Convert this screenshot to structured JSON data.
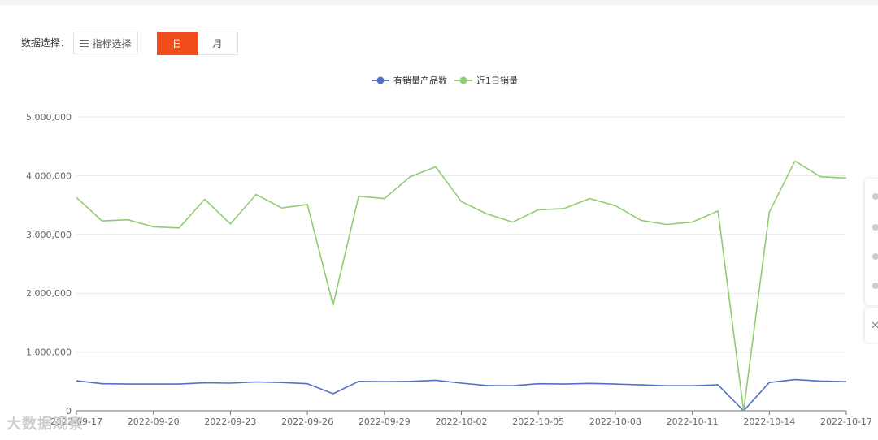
{
  "filter": {
    "label": "数据选择：",
    "metric_button": "指标选择",
    "period_day": "日",
    "period_month": "月",
    "active_period": "日"
  },
  "colors": {
    "accent": "#f04c1c",
    "series1": "#5470c6",
    "series2": "#91cc75"
  },
  "watermark": "大数据观察",
  "chart_data": {
    "type": "line",
    "title": "",
    "xlabel": "",
    "ylabel": "",
    "ylim": [
      0,
      5000000
    ],
    "yticks": [
      0,
      1000000,
      2000000,
      3000000,
      4000000,
      5000000
    ],
    "ytick_labels": [
      "0",
      "1,000,000",
      "2,000,000",
      "3,000,000",
      "4,000,000",
      "5,000,000"
    ],
    "xtick_labels": [
      "2022-09-17",
      "2022-09-20",
      "2022-09-23",
      "2022-09-26",
      "2022-09-29",
      "2022-10-02",
      "2022-10-05",
      "2022-10-08",
      "2022-10-11",
      "2022-10-14",
      "2022-10-17"
    ],
    "legend_position": "top-center",
    "grid": true,
    "x": [
      "2022-09-17",
      "2022-09-18",
      "2022-09-19",
      "2022-09-20",
      "2022-09-21",
      "2022-09-22",
      "2022-09-23",
      "2022-09-24",
      "2022-09-25",
      "2022-09-26",
      "2022-09-27",
      "2022-09-28",
      "2022-09-29",
      "2022-09-30",
      "2022-10-01",
      "2022-10-02",
      "2022-10-03",
      "2022-10-04",
      "2022-10-05",
      "2022-10-06",
      "2022-10-07",
      "2022-10-08",
      "2022-10-09",
      "2022-10-10",
      "2022-10-11",
      "2022-10-12",
      "2022-10-13",
      "2022-10-14",
      "2022-10-15",
      "2022-10-16",
      "2022-10-17"
    ],
    "series": [
      {
        "name": "有销量产品数",
        "color": "#5470c6",
        "values": [
          510000,
          460000,
          455000,
          455000,
          455000,
          475000,
          470000,
          490000,
          480000,
          460000,
          290000,
          500000,
          495000,
          500000,
          520000,
          470000,
          430000,
          425000,
          460000,
          455000,
          465000,
          455000,
          440000,
          425000,
          425000,
          440000,
          0,
          480000,
          530000,
          505000,
          495000
        ]
      },
      {
        "name": "近1日销量",
        "color": "#91cc75",
        "values": [
          3630000,
          3230000,
          3250000,
          3130000,
          3110000,
          3600000,
          3180000,
          3680000,
          3450000,
          3510000,
          1800000,
          3650000,
          3610000,
          3980000,
          4150000,
          3560000,
          3350000,
          3210000,
          3420000,
          3440000,
          3610000,
          3490000,
          3240000,
          3170000,
          3210000,
          3400000,
          0,
          3380000,
          4250000,
          3980000,
          3960000
        ]
      }
    ]
  }
}
